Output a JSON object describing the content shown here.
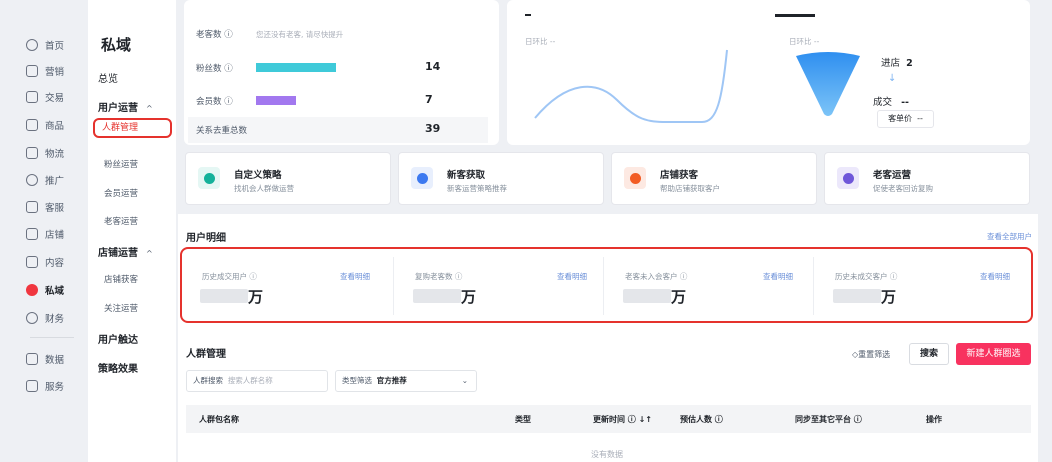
{
  "rail": {
    "items": [
      {
        "label": "首页",
        "icon": "home-icon"
      },
      {
        "label": "营销",
        "icon": "megaphone-icon"
      },
      {
        "label": "交易",
        "icon": "receipt-icon"
      },
      {
        "label": "商品",
        "icon": "bag-icon"
      },
      {
        "label": "物流",
        "icon": "truck-icon"
      },
      {
        "label": "推广",
        "icon": "location-icon"
      },
      {
        "label": "客服",
        "icon": "headset-icon"
      },
      {
        "label": "店铺",
        "icon": "store-icon"
      },
      {
        "label": "内容",
        "icon": "content-icon"
      },
      {
        "label": "私域",
        "icon": "user-circle-icon"
      },
      {
        "label": "财务",
        "icon": "coin-icon"
      },
      {
        "label": "数据",
        "icon": "chart-icon"
      },
      {
        "label": "服务",
        "icon": "grid-icon"
      }
    ]
  },
  "nav": {
    "title": "私域",
    "overview": "总览",
    "group_user": "用户运营",
    "chev": "^",
    "items_user": [
      "人群管理",
      "粉丝运营",
      "会员运营",
      "老客运营"
    ],
    "group_store": "店铺运营",
    "items_store": [
      "店铺获客",
      "关注运营"
    ],
    "reach": "用户触达",
    "effect": "策略效果"
  },
  "summary": {
    "old_label": "老客数 ⓘ",
    "old_hint": "您还没有老客, 请尽快提升",
    "fans_label": "粉丝数 ⓘ",
    "fans_value": "14",
    "members_label": "会员数 ⓘ",
    "members_value": "7",
    "dedupe_label": "关系去重总数",
    "dedupe_value": "39",
    "colors": {
      "fans": "#3fcad9",
      "members": "#a278ef"
    }
  },
  "trend": {
    "compare": "日环比 --"
  },
  "funnel": {
    "compare": "日环比 --",
    "in_label": "进店",
    "in_value": "2",
    "deal_label": "成交",
    "deal_value": "--",
    "avg_label": "客单价",
    "avg_value": "--"
  },
  "cards": [
    {
      "title": "自定义策略",
      "desc": "找机会人群做运营",
      "icon": "target-icon",
      "bg": "#e5f7f4",
      "fg": "#14b19a"
    },
    {
      "title": "新客获取",
      "desc": "新客运营策略推荐",
      "icon": "new-user-icon",
      "bg": "#e8effd",
      "fg": "#3c79f0"
    },
    {
      "title": "店铺获客",
      "desc": "帮助店铺获取客户",
      "icon": "shop-icon",
      "bg": "#fde9e2",
      "fg": "#f25c24"
    },
    {
      "title": "老客运营",
      "desc": "促使老客回访复购",
      "icon": "users-icon",
      "bg": "#ece8fb",
      "fg": "#6f57d9"
    }
  ],
  "user_detail": {
    "title": "用户明细",
    "view_all": "查看全部用户",
    "link": "查看明细",
    "unit": "万",
    "stats": [
      "历史成交用户 ⓘ",
      "复购老客数 ⓘ",
      "老客未入会客户 ⓘ",
      "历史未成交客户 ⓘ"
    ]
  },
  "crowd": {
    "title": "人群管理",
    "reset": "重置筛选",
    "search_btn": "搜索",
    "new_btn": "新建人群圈选",
    "filter_label": "人群搜索",
    "filter_placeholder": "搜索人群名称",
    "type_label": "类型筛选",
    "type_value": "官方推荐",
    "columns": [
      "人群包名称",
      "类型",
      "更新时间 ⓘ ↓↑",
      "预估人数 ⓘ",
      "同步至其它平台 ⓘ",
      "操作"
    ],
    "empty": "没有数据"
  }
}
